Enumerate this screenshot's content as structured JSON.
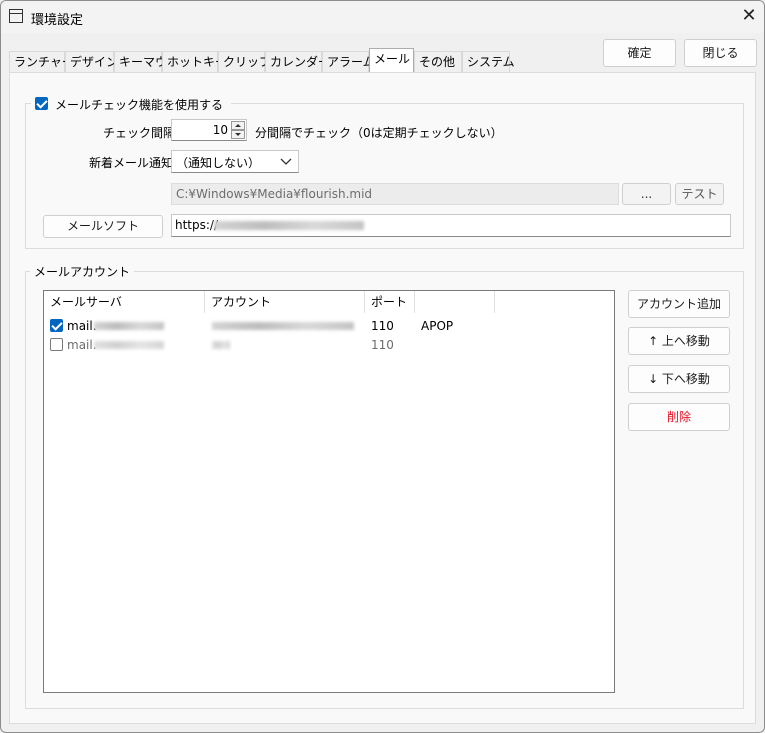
{
  "window": {
    "title": "環境設定",
    "close_glyph": "✕"
  },
  "tabs": [
    {
      "label": "ランチャー"
    },
    {
      "label": "デザイン"
    },
    {
      "label": "キーマウ"
    },
    {
      "label": "ホットキー"
    },
    {
      "label": "クリップ"
    },
    {
      "label": "カレンダー"
    },
    {
      "label": "アラーム"
    },
    {
      "label": "メール",
      "active": true
    },
    {
      "label": "その他"
    },
    {
      "label": "システム"
    }
  ],
  "top_buttons": {
    "confirm": "確定",
    "close": "閉じる"
  },
  "mail_check": {
    "enable_label": "メールチェック機能を使用する",
    "enabled": true,
    "interval_label": "チェック間隔",
    "interval_value": "10",
    "interval_suffix": "分間隔でチェック（0は定期チェックしない）",
    "notify_label": "新着メール通知",
    "notify_value": "（通知しない）",
    "sound_path": "C:¥Windows¥Media¥flourish.mid",
    "browse_label": "...",
    "test_label": "テスト",
    "mail_soft_label": "メールソフト",
    "mail_soft_url": "https://"
  },
  "accounts": {
    "legend": "メールアカウント",
    "columns": [
      "メールサーバ",
      "アカウント",
      "ポート",
      ""
    ],
    "rows": [
      {
        "checked": true,
        "server": "mail.",
        "port": "110",
        "auth": "APOP"
      },
      {
        "checked": false,
        "server": "mail.",
        "port": "110",
        "auth": ""
      }
    ],
    "buttons": {
      "add": "アカウント追加",
      "up": "↑ 上へ移動",
      "down": "↓ 下へ移動",
      "delete": "削除"
    }
  },
  "colors": {
    "accent": "#0067c0",
    "delete_text": "#e81123",
    "disabled_text": "#6d6d6d"
  },
  "icons": {
    "window": "window-icon",
    "close": "close-icon",
    "spin_up": "spin-up-icon",
    "spin_down": "spin-down-icon",
    "dropdown": "chevron-down-icon"
  }
}
